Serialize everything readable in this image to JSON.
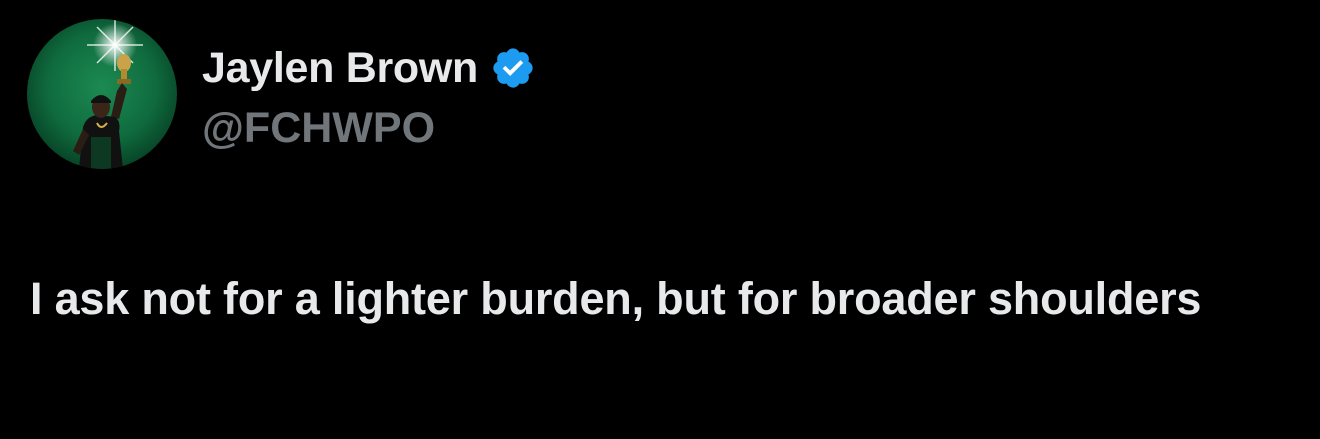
{
  "author": {
    "display_name": "Jaylen Brown",
    "handle": "@FCHWPO",
    "verified": true,
    "avatar_icon": "profile-photo-trophy"
  },
  "tweet": {
    "text": "I ask not for a lighter burden, but for broader shoulders"
  },
  "colors": {
    "background": "#000000",
    "primary_text": "#e7e9ea",
    "secondary_text": "#71767b",
    "verified_badge": "#1d9bf0",
    "avatar_background": "#0f6b3e"
  }
}
